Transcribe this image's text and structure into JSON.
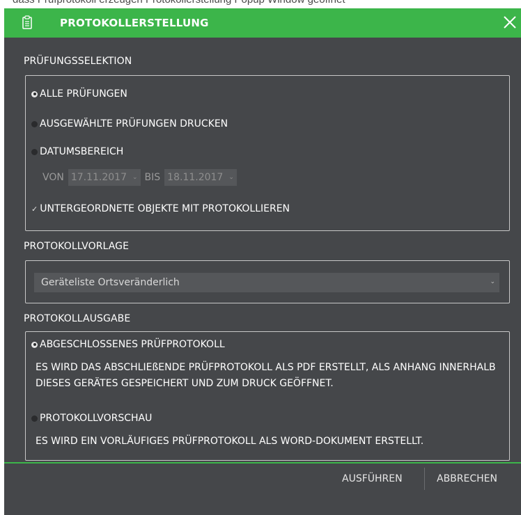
{
  "window": {
    "title": "PROTOKOLLERSTELLUNG",
    "close_label": "✕"
  },
  "background_text": "dass Prüfprotokoll erzeugen Protokollerstellung Popup Window geöffnet",
  "sections": {
    "pruefung": {
      "label": "PRÜFUNGSSELEKTION",
      "options": [
        {
          "label": "ALLE PRÜFUNGEN",
          "selected": true
        },
        {
          "label": "AUSGEWÄHLTE PRÜFUNGEN DRUCKEN",
          "selected": false
        },
        {
          "label": "DATUMSBEREICH",
          "selected": false
        }
      ],
      "date_range": {
        "from_label": "VON",
        "from_value": "17.11.2017",
        "to_label": "BIS",
        "to_value": "18.11.2017"
      },
      "checkbox": {
        "label": "UNTERGEORDNETE OBJEKTE MIT PROTOKOLLIEREN",
        "checked": true
      }
    },
    "vorlage": {
      "label": "PROTOKOLLVORLAGE",
      "selected": "Geräteliste Ortsveränderlich"
    },
    "ausgabe": {
      "label": "PROTOKOLLAUSGABE",
      "options": [
        {
          "label": "ABGESCHLOSSENES PRÜFPROTOKOLL",
          "selected": true,
          "description": "ES WIRD DAS ABSCHLIEßENDE PRÜFPROTOKOLL ALS PDF ERSTELLT, ALS ANHANG INNERHALB DIESES GERÄTES GESPEICHERT UND ZUM DRUCK GEÖFFNET."
        },
        {
          "label": "PROTOKOLLVORSCHAU",
          "selected": false,
          "description": "ES WIRD EIN VORLÄUFIGES PRÜFPROTOKOLL ALS WORD-DOKUMENT ERSTELLT."
        }
      ]
    }
  },
  "footer": {
    "run_label": "AUSFÜHREN",
    "cancel_label": "ABBRECHEN"
  },
  "colors": {
    "accent": "#3cb54a",
    "dialog_bg": "#45474a",
    "field_bg": "#55575a"
  },
  "icons": {
    "title": "clipboard-icon",
    "close": "close-icon"
  }
}
